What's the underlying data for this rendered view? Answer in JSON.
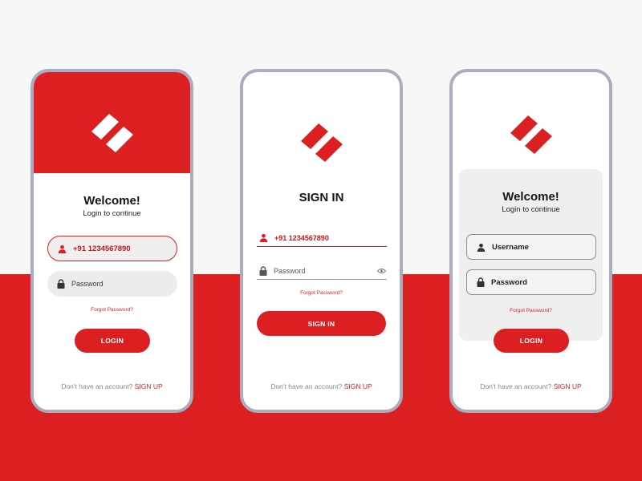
{
  "colors": {
    "accent": "#dc1f20",
    "phone_frame": "#a9adbf",
    "background_top": "#f7f7f8"
  },
  "screen1": {
    "title": "Welcome!",
    "subtitle": "Login to continue",
    "phone_value": "+91 1234567890",
    "phone_icon": "user-icon",
    "password_placeholder": "Password",
    "password_icon": "lock-icon",
    "forgot": "Forgot Password?",
    "login": "LOGIN",
    "signup_prompt": "Don't have an account?",
    "signup_link": "SIGN UP"
  },
  "screen2": {
    "title": "SIGN IN",
    "phone_value": "+91 1234567890",
    "phone_icon": "user-icon",
    "password_placeholder": "Password",
    "password_icon": "lock-icon",
    "visibility_icon": "eye-icon",
    "forgot": "Forgot Password?",
    "signin": "SIGN IN",
    "signup_prompt": "Don't have an account?",
    "signup_link": "SIGN UP"
  },
  "screen3": {
    "title": "Welcome!",
    "subtitle": "Login to continue",
    "username_placeholder": "Username",
    "username_icon": "user-icon",
    "password_placeholder": "Password",
    "password_icon": "lock-icon",
    "forgot": "Forgot Password?",
    "login": "LOGIN",
    "signup_prompt": "Don't have an account?",
    "signup_link": "SIGN UP"
  }
}
